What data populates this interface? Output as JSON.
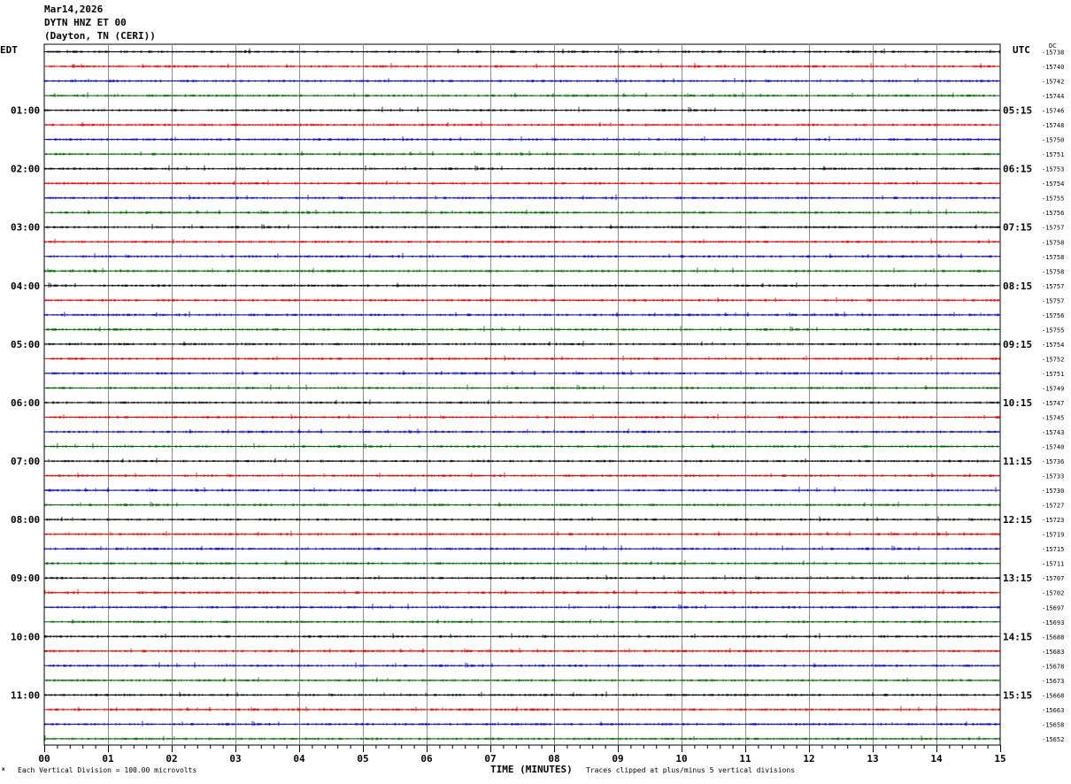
{
  "header": {
    "date": "Mar14,2026",
    "station": "DYTN HNZ ET 00",
    "location": "(Dayton, TN (CERI))"
  },
  "left_tz": "EDT",
  "right_tz": "UTC",
  "dc_label": "DC",
  "footer": {
    "scale_note": "Each Vertical Division =  100.00 microvolts",
    "clip_note": "Traces clipped at plus/minus 5 vertical divisions"
  },
  "chart_data": {
    "type": "line",
    "title": "DYTN HNZ ET 00",
    "xlabel": "TIME (MINUTES)",
    "ylabel": "",
    "xlim": [
      0,
      15
    ],
    "x_ticks": [
      "00",
      "01",
      "02",
      "03",
      "04",
      "05",
      "06",
      "07",
      "08",
      "09",
      "10",
      "11",
      "12",
      "13",
      "14",
      "15"
    ],
    "row_colors": [
      "#000000",
      "#e00000",
      "#0000c8",
      "#006400"
    ],
    "left_hour_labels": [
      "01:00",
      "02:00",
      "03:00",
      "04:00",
      "05:00",
      "06:00",
      "07:00",
      "08:00",
      "09:00",
      "10:00",
      "11:00"
    ],
    "right_hour_labels": [
      "05:15",
      "06:15",
      "07:15",
      "08:15",
      "09:15",
      "10:15",
      "11:15",
      "12:15",
      "13:15",
      "14:15",
      "15:15"
    ],
    "dc_offsets": [
      -15738,
      -15740,
      -15742,
      -15744,
      -15746,
      -15748,
      -15750,
      -15751,
      -15753,
      -15754,
      -15755,
      -15756,
      -15757,
      -15758,
      -15758,
      -15758,
      -15757,
      -15757,
      -15756,
      -15755,
      -15754,
      -15752,
      -15751,
      -15749,
      -15747,
      -15745,
      -15743,
      -15740,
      -15736,
      -15733,
      -15730,
      -15727,
      -15723,
      -15719,
      -15715,
      -15711,
      -15707,
      -15702,
      -15697,
      -15693,
      -15688,
      -15683,
      -15678,
      -15673,
      -15668,
      -15663,
      -15658,
      -15652
    ]
  }
}
